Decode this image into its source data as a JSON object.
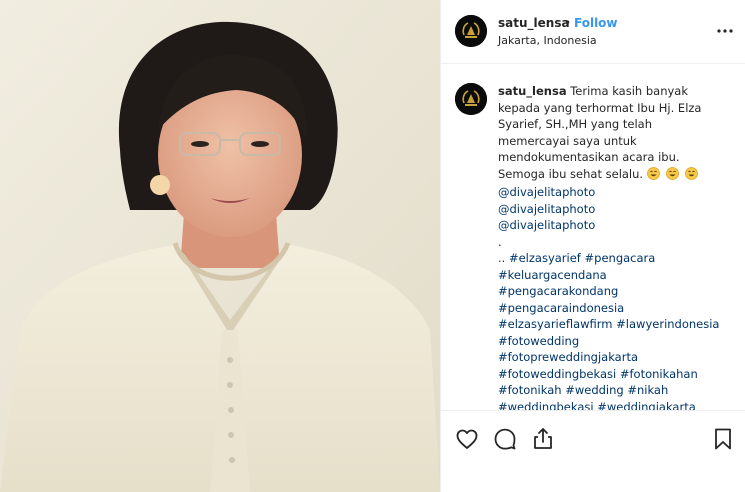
{
  "post": {
    "username": "satu_lensa",
    "separator": "•",
    "follow_label": "Follow",
    "location": "Jakarta, Indonesia"
  },
  "caption": {
    "username": "satu_lensa",
    "lines": [
      "Terima kasih banyak",
      "kepada yang terhormat Ibu Hj. Elza",
      "Syarief, SH.,MH yang telah",
      "memercayai saya untuk",
      "mendokumentasikan acara ibu.",
      "Semoga ibu sehat selalu."
    ],
    "mentions": [
      "@divajelitaphoto",
      "@divajelitaphoto",
      "@divajelitaphoto"
    ],
    "dot_line": ".",
    "hashtag_prefix": "..",
    "hashtags": [
      [
        "#elzasyarief",
        "#pengacara"
      ],
      [
        "#keluargacendana"
      ],
      [
        "#pengacarakondang"
      ],
      [
        "#pengacaraindonesia"
      ],
      [
        "#elzasyarieflawfirm",
        "#lawyerindonesia"
      ],
      [
        "#fotowedding"
      ],
      [
        "#fotopreweddingjakarta"
      ],
      [
        "#fotoweddingbekasi",
        "#fotonikahan"
      ],
      [
        "#fotonikah",
        "#wedding",
        "#nikah"
      ],
      [
        "#weddingbekasi",
        "#weddingjakarta"
      ]
    ]
  },
  "icons": {
    "avatar": "gold-laurel-logo-icon",
    "more": "more-options-icon",
    "like": "heart-icon",
    "comment": "comment-icon",
    "share": "share-icon",
    "save": "bookmark-icon",
    "emoji": "smiling-face-emoji"
  },
  "colors": {
    "link": "#003569",
    "follow": "#3897f0",
    "text": "#262626",
    "border": "#efefef",
    "logo_gold": "#c9a13a"
  }
}
